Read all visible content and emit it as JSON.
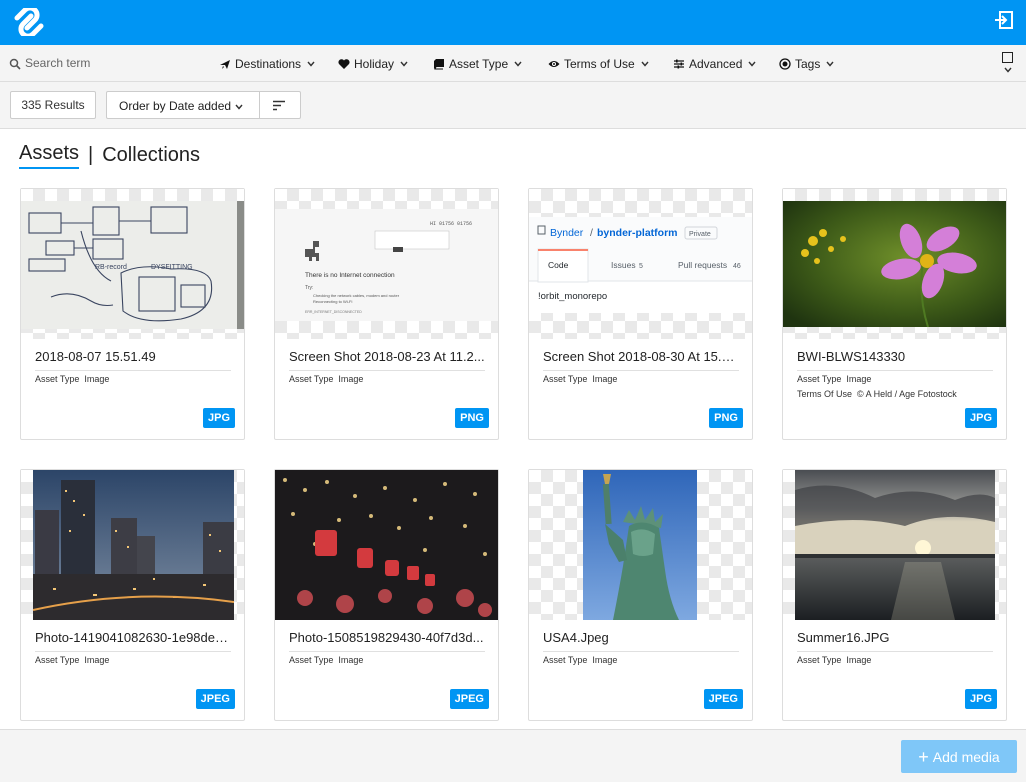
{
  "colors": {
    "brand": "#0095f3",
    "badge": "#0095f3",
    "add_button": "#7fc7f8"
  },
  "search": {
    "placeholder": "Search term"
  },
  "filters": [
    {
      "label": "Destinations",
      "icon": "airplane-icon"
    },
    {
      "label": "Holiday",
      "icon": "heart-icon"
    },
    {
      "label": "Asset Type",
      "icon": "book-icon"
    },
    {
      "label": "Terms of Use",
      "icon": "eye-icon"
    },
    {
      "label": "Advanced",
      "icon": "sliders-icon"
    },
    {
      "label": "Tags",
      "icon": "tag-circle-icon"
    }
  ],
  "toolbar": {
    "results": "335 Results",
    "order_label": "Order by Date added"
  },
  "tabs": {
    "assets": "Assets",
    "collections": "Collections"
  },
  "assets": [
    {
      "title": "2018-08-07 15.51.49",
      "asset_type_key": "Asset Type",
      "asset_type": "Image",
      "badge": "JPG",
      "thumb": "whiteboard"
    },
    {
      "title": "Screen Shot 2018-08-23 At 11.2...",
      "asset_type_key": "Asset Type",
      "asset_type": "Image",
      "badge": "PNG",
      "thumb": "no-internet",
      "thumb_text": {
        "offline": "There is no Internet connection",
        "try": "Try:",
        "tip1": "Checking the network cables, modem and router",
        "tip2": "Reconnecting to Wi-Fi",
        "code": "ERR_INTERNET_DISCONNECTED"
      }
    },
    {
      "title": "Screen Shot 2018-08-30 At 15.3...",
      "asset_type_key": "Asset Type",
      "asset_type": "Image",
      "badge": "PNG",
      "thumb": "github",
      "thumb_text": {
        "org": "Bynder",
        "repo": "bynder-platform",
        "private": "Private",
        "code": "Code",
        "issues": "Issues",
        "issues_count": "5",
        "pulls": "Pull requests",
        "pulls_count": "46",
        "branch": "!orbit_monorepo"
      }
    },
    {
      "title": "BWI-BLWS143330",
      "asset_type_key": "Asset Type",
      "asset_type": "Image",
      "terms_key": "Terms Of Use",
      "terms": "© A Held / Age Fotostock",
      "badge": "JPG",
      "thumb": "flower"
    },
    {
      "title": "Photo-1419041082630-1e98deb...",
      "asset_type_key": "Asset Type",
      "asset_type": "Image",
      "badge": "JPEG",
      "thumb": "city"
    },
    {
      "title": "Photo-1508519829430-40f7d3d...",
      "asset_type_key": "Asset Type",
      "asset_type": "Image",
      "badge": "JPEG",
      "thumb": "lights"
    },
    {
      "title": "USA4.Jpeg",
      "asset_type_key": "Asset Type",
      "asset_type": "Image",
      "badge": "JPEG",
      "thumb": "liberty"
    },
    {
      "title": "Summer16.JPG",
      "asset_type_key": "Asset Type",
      "asset_type": "Image",
      "badge": "JPG",
      "thumb": "sunset"
    }
  ],
  "footer": {
    "add_media": "Add media"
  }
}
